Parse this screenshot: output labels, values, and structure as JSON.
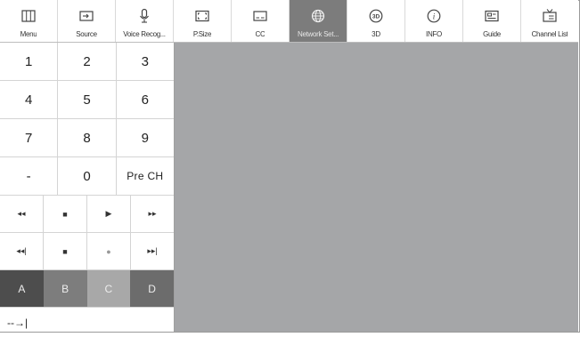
{
  "toolbar": {
    "buttons": [
      {
        "label": "Menu",
        "icon": "menu-grid-icon"
      },
      {
        "label": "Source",
        "icon": "source-input-icon"
      },
      {
        "label": "Voice Recog...",
        "icon": "microphone-icon"
      },
      {
        "label": "P.Size",
        "icon": "picture-size-icon"
      },
      {
        "label": "CC",
        "icon": "closed-caption-icon"
      },
      {
        "label": "Network Set...",
        "icon": "globe-network-icon",
        "active": true
      },
      {
        "label": "3D",
        "icon": "3d-icon"
      },
      {
        "label": "INFO",
        "icon": "info-icon"
      },
      {
        "label": "Guide",
        "icon": "guide-icon"
      },
      {
        "label": "Channel List",
        "icon": "channel-list-icon"
      }
    ]
  },
  "keypad": {
    "row1": [
      "1",
      "2",
      "3"
    ],
    "row2": [
      "4",
      "5",
      "6"
    ],
    "row3": [
      "7",
      "8",
      "9"
    ],
    "row4": [
      "-",
      "0",
      "Pre CH"
    ],
    "transport1": [
      "◂◂",
      "■",
      "▶",
      "▸▸"
    ],
    "transport2": [
      "◂◂|",
      "■",
      "●",
      "▸▸|"
    ],
    "colors": [
      "A",
      "B",
      "C",
      "D"
    ],
    "tail": "--→|"
  },
  "colors": {
    "active_tab": "#7c7c7c",
    "content_bg": "#a5a6a8",
    "key_a": "#4d4d4d",
    "key_b": "#7d7d7d",
    "key_c": "#a8a8a8",
    "key_d": "#6c6c6c"
  }
}
